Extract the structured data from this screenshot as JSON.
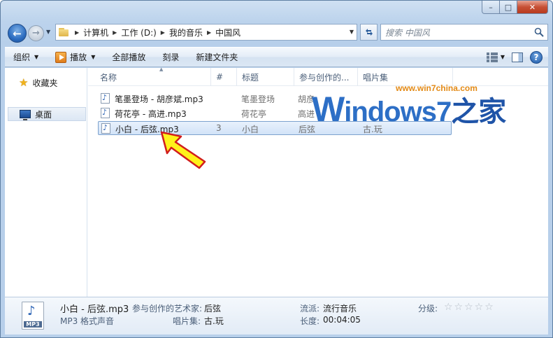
{
  "window": {
    "caption": {
      "minimize_glyph": "–",
      "maximize_glyph": "□",
      "close_glyph": "✕"
    }
  },
  "nav": {
    "back_glyph": "←",
    "forward_glyph": "→",
    "breadcrumbs": [
      "计算机",
      "工作 (D:)",
      "我的音乐",
      "中国风"
    ],
    "search_placeholder": "搜索 中国风"
  },
  "commands": {
    "organize": "组织",
    "play": "播放",
    "play_all": "全部播放",
    "burn": "刻录",
    "new_folder": "新建文件夹"
  },
  "navpane": {
    "favorites": "收藏夹",
    "desktop": "桌面"
  },
  "columns": [
    "名称",
    "#",
    "标题",
    "参与创作的...",
    "唱片集"
  ],
  "files": [
    {
      "name": "笔墨登场 - 胡彦斌.mp3",
      "track": "",
      "title": "笔墨登场",
      "artist": "胡彦",
      "album": "",
      "selected": false
    },
    {
      "name": "荷花亭 - 高进.mp3",
      "track": "",
      "title": "荷花亭",
      "artist": "高进",
      "album": "",
      "selected": false
    },
    {
      "name": "小白 - 后弦.mp3",
      "track": "3",
      "title": "小白",
      "artist": "后弦",
      "album": "古.玩",
      "selected": true
    }
  ],
  "watermark": {
    "url": "www.win7china.com",
    "logo_w": "W",
    "logo_rest": "indows7",
    "logo_cn": "之家"
  },
  "details": {
    "filename": "小白 - 后弦.mp3",
    "file_type": "MP3 格式声音",
    "icon_label": "MP3",
    "artist_key": "参与创作的艺术家:",
    "artist_val": "后弦",
    "album_key": "唱片集:",
    "album_val": "古.玩",
    "genre_key": "流派:",
    "genre_val": "流行音乐",
    "length_key": "长度:",
    "length_val": "00:04:05",
    "rating_key": "分级:",
    "rating_stars": "☆☆☆☆☆"
  }
}
